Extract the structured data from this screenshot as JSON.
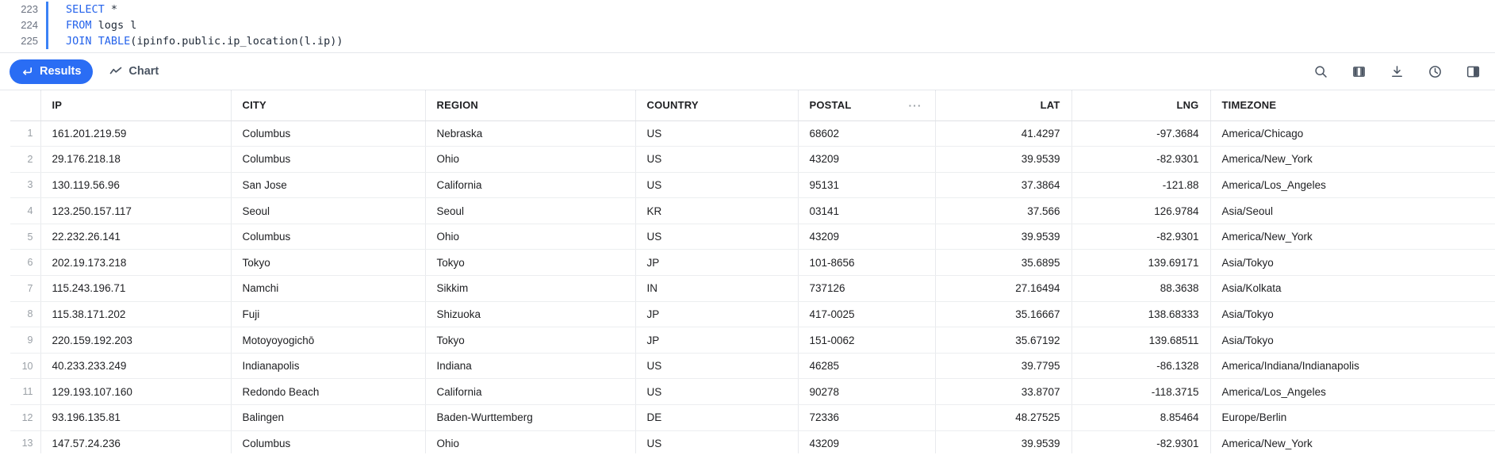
{
  "editor": {
    "lines": [
      {
        "number": "223",
        "tokens": [
          {
            "t": "SELECT",
            "k": true
          },
          {
            "t": " *",
            "k": false
          }
        ]
      },
      {
        "number": "224",
        "tokens": [
          {
            "t": "FROM",
            "k": true
          },
          {
            "t": " logs l",
            "k": false
          }
        ]
      },
      {
        "number": "225",
        "tokens": [
          {
            "t": "JOIN TABLE",
            "k": true
          },
          {
            "t": "(ipinfo.public.ip_location(l.ip))",
            "k": false
          }
        ]
      }
    ],
    "line_223_number": "223",
    "line_224_number": "224",
    "line_225_number": "225",
    "line_223_kw": "SELECT",
    "line_223_rest": " *",
    "line_224_kw": "FROM",
    "line_224_rest": " logs l",
    "line_225_kw": "JOIN TABLE",
    "line_225_rest": "(ipinfo.public.ip_location(l.ip))"
  },
  "toolbar": {
    "results_tab_label": "Results",
    "chart_tab_label": "Chart",
    "active_tab": "Results",
    "accent_color": "#2a6df4",
    "icons": [
      "search-icon",
      "columns-icon",
      "download-icon",
      "history-clock-icon",
      "side-panel-icon"
    ]
  },
  "results_table": {
    "columns": [
      {
        "key": "ip",
        "label": "IP",
        "align": "left"
      },
      {
        "key": "city",
        "label": "CITY",
        "align": "left"
      },
      {
        "key": "region",
        "label": "REGION",
        "align": "left"
      },
      {
        "key": "country",
        "label": "COUNTRY",
        "align": "left"
      },
      {
        "key": "postal",
        "label": "POSTAL",
        "align": "left",
        "menu": "···"
      },
      {
        "key": "lat",
        "label": "LAT",
        "align": "right"
      },
      {
        "key": "lng",
        "label": "LNG",
        "align": "right"
      },
      {
        "key": "timezone",
        "label": "TIMEZONE",
        "align": "left"
      }
    ],
    "headers": {
      "ip": "IP",
      "city": "CITY",
      "region": "REGION",
      "country": "COUNTRY",
      "postal": "POSTAL",
      "postal_menu": "···",
      "lat": "LAT",
      "lng": "LNG",
      "timezone": "TIMEZONE"
    },
    "rows": [
      {
        "n": "1",
        "ip": "161.201.219.59",
        "city": "Columbus",
        "region": "Nebraska",
        "country": "US",
        "postal": "68602",
        "lat": "41.4297",
        "lng": "-97.3684",
        "timezone": "America/Chicago"
      },
      {
        "n": "2",
        "ip": "29.176.218.18",
        "city": "Columbus",
        "region": "Ohio",
        "country": "US",
        "postal": "43209",
        "lat": "39.9539",
        "lng": "-82.9301",
        "timezone": "America/New_York"
      },
      {
        "n": "3",
        "ip": "130.119.56.96",
        "city": "San Jose",
        "region": "California",
        "country": "US",
        "postal": "95131",
        "lat": "37.3864",
        "lng": "-121.88",
        "timezone": "America/Los_Angeles"
      },
      {
        "n": "4",
        "ip": "123.250.157.117",
        "city": "Seoul",
        "region": "Seoul",
        "country": "KR",
        "postal": "03141",
        "lat": "37.566",
        "lng": "126.9784",
        "timezone": "Asia/Seoul"
      },
      {
        "n": "5",
        "ip": "22.232.26.141",
        "city": "Columbus",
        "region": "Ohio",
        "country": "US",
        "postal": "43209",
        "lat": "39.9539",
        "lng": "-82.9301",
        "timezone": "America/New_York"
      },
      {
        "n": "6",
        "ip": "202.19.173.218",
        "city": "Tokyo",
        "region": "Tokyo",
        "country": "JP",
        "postal": "101-8656",
        "lat": "35.6895",
        "lng": "139.69171",
        "timezone": "Asia/Tokyo"
      },
      {
        "n": "7",
        "ip": "115.243.196.71",
        "city": "Namchi",
        "region": "Sikkim",
        "country": "IN",
        "postal": "737126",
        "lat": "27.16494",
        "lng": "88.3638",
        "timezone": "Asia/Kolkata"
      },
      {
        "n": "8",
        "ip": "115.38.171.202",
        "city": "Fuji",
        "region": "Shizuoka",
        "country": "JP",
        "postal": "417-0025",
        "lat": "35.16667",
        "lng": "138.68333",
        "timezone": "Asia/Tokyo"
      },
      {
        "n": "9",
        "ip": "220.159.192.203",
        "city": "Motoyoyogichō",
        "region": "Tokyo",
        "country": "JP",
        "postal": "151-0062",
        "lat": "35.67192",
        "lng": "139.68511",
        "timezone": "Asia/Tokyo"
      },
      {
        "n": "10",
        "ip": "40.233.233.249",
        "city": "Indianapolis",
        "region": "Indiana",
        "country": "US",
        "postal": "46285",
        "lat": "39.7795",
        "lng": "-86.1328",
        "timezone": "America/Indiana/Indianapolis"
      },
      {
        "n": "11",
        "ip": "129.193.107.160",
        "city": "Redondo Beach",
        "region": "California",
        "country": "US",
        "postal": "90278",
        "lat": "33.8707",
        "lng": "-118.3715",
        "timezone": "America/Los_Angeles"
      },
      {
        "n": "12",
        "ip": "93.196.135.81",
        "city": "Balingen",
        "region": "Baden-Wurttemberg",
        "country": "DE",
        "postal": "72336",
        "lat": "48.27525",
        "lng": "8.85464",
        "timezone": "Europe/Berlin"
      },
      {
        "n": "13",
        "ip": "147.57.24.236",
        "city": "Columbus",
        "region": "Ohio",
        "country": "US",
        "postal": "43209",
        "lat": "39.9539",
        "lng": "-82.9301",
        "timezone": "America/New_York"
      }
    ]
  }
}
